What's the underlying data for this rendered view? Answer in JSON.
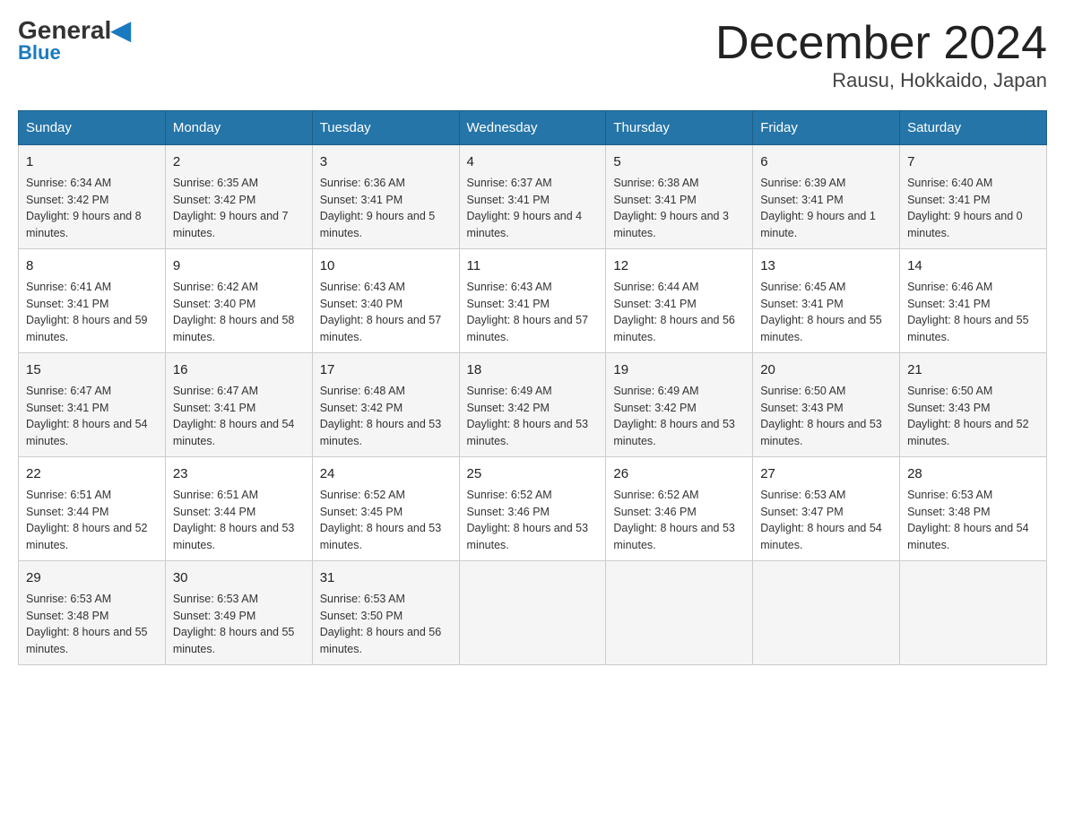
{
  "logo": {
    "general": "General",
    "blue": "Blue"
  },
  "title": "December 2024",
  "subtitle": "Rausu, Hokkaido, Japan",
  "days_of_week": [
    "Sunday",
    "Monday",
    "Tuesday",
    "Wednesday",
    "Thursday",
    "Friday",
    "Saturday"
  ],
  "weeks": [
    [
      {
        "day": "1",
        "sunrise": "6:34 AM",
        "sunset": "3:42 PM",
        "daylight": "9 hours and 8 minutes."
      },
      {
        "day": "2",
        "sunrise": "6:35 AM",
        "sunset": "3:42 PM",
        "daylight": "9 hours and 7 minutes."
      },
      {
        "day": "3",
        "sunrise": "6:36 AM",
        "sunset": "3:41 PM",
        "daylight": "9 hours and 5 minutes."
      },
      {
        "day": "4",
        "sunrise": "6:37 AM",
        "sunset": "3:41 PM",
        "daylight": "9 hours and 4 minutes."
      },
      {
        "day": "5",
        "sunrise": "6:38 AM",
        "sunset": "3:41 PM",
        "daylight": "9 hours and 3 minutes."
      },
      {
        "day": "6",
        "sunrise": "6:39 AM",
        "sunset": "3:41 PM",
        "daylight": "9 hours and 1 minute."
      },
      {
        "day": "7",
        "sunrise": "6:40 AM",
        "sunset": "3:41 PM",
        "daylight": "9 hours and 0 minutes."
      }
    ],
    [
      {
        "day": "8",
        "sunrise": "6:41 AM",
        "sunset": "3:41 PM",
        "daylight": "8 hours and 59 minutes."
      },
      {
        "day": "9",
        "sunrise": "6:42 AM",
        "sunset": "3:40 PM",
        "daylight": "8 hours and 58 minutes."
      },
      {
        "day": "10",
        "sunrise": "6:43 AM",
        "sunset": "3:40 PM",
        "daylight": "8 hours and 57 minutes."
      },
      {
        "day": "11",
        "sunrise": "6:43 AM",
        "sunset": "3:41 PM",
        "daylight": "8 hours and 57 minutes."
      },
      {
        "day": "12",
        "sunrise": "6:44 AM",
        "sunset": "3:41 PM",
        "daylight": "8 hours and 56 minutes."
      },
      {
        "day": "13",
        "sunrise": "6:45 AM",
        "sunset": "3:41 PM",
        "daylight": "8 hours and 55 minutes."
      },
      {
        "day": "14",
        "sunrise": "6:46 AM",
        "sunset": "3:41 PM",
        "daylight": "8 hours and 55 minutes."
      }
    ],
    [
      {
        "day": "15",
        "sunrise": "6:47 AM",
        "sunset": "3:41 PM",
        "daylight": "8 hours and 54 minutes."
      },
      {
        "day": "16",
        "sunrise": "6:47 AM",
        "sunset": "3:41 PM",
        "daylight": "8 hours and 54 minutes."
      },
      {
        "day": "17",
        "sunrise": "6:48 AM",
        "sunset": "3:42 PM",
        "daylight": "8 hours and 53 minutes."
      },
      {
        "day": "18",
        "sunrise": "6:49 AM",
        "sunset": "3:42 PM",
        "daylight": "8 hours and 53 minutes."
      },
      {
        "day": "19",
        "sunrise": "6:49 AM",
        "sunset": "3:42 PM",
        "daylight": "8 hours and 53 minutes."
      },
      {
        "day": "20",
        "sunrise": "6:50 AM",
        "sunset": "3:43 PM",
        "daylight": "8 hours and 53 minutes."
      },
      {
        "day": "21",
        "sunrise": "6:50 AM",
        "sunset": "3:43 PM",
        "daylight": "8 hours and 52 minutes."
      }
    ],
    [
      {
        "day": "22",
        "sunrise": "6:51 AM",
        "sunset": "3:44 PM",
        "daylight": "8 hours and 52 minutes."
      },
      {
        "day": "23",
        "sunrise": "6:51 AM",
        "sunset": "3:44 PM",
        "daylight": "8 hours and 53 minutes."
      },
      {
        "day": "24",
        "sunrise": "6:52 AM",
        "sunset": "3:45 PM",
        "daylight": "8 hours and 53 minutes."
      },
      {
        "day": "25",
        "sunrise": "6:52 AM",
        "sunset": "3:46 PM",
        "daylight": "8 hours and 53 minutes."
      },
      {
        "day": "26",
        "sunrise": "6:52 AM",
        "sunset": "3:46 PM",
        "daylight": "8 hours and 53 minutes."
      },
      {
        "day": "27",
        "sunrise": "6:53 AM",
        "sunset": "3:47 PM",
        "daylight": "8 hours and 54 minutes."
      },
      {
        "day": "28",
        "sunrise": "6:53 AM",
        "sunset": "3:48 PM",
        "daylight": "8 hours and 54 minutes."
      }
    ],
    [
      {
        "day": "29",
        "sunrise": "6:53 AM",
        "sunset": "3:48 PM",
        "daylight": "8 hours and 55 minutes."
      },
      {
        "day": "30",
        "sunrise": "6:53 AM",
        "sunset": "3:49 PM",
        "daylight": "8 hours and 55 minutes."
      },
      {
        "day": "31",
        "sunrise": "6:53 AM",
        "sunset": "3:50 PM",
        "daylight": "8 hours and 56 minutes."
      },
      null,
      null,
      null,
      null
    ]
  ]
}
